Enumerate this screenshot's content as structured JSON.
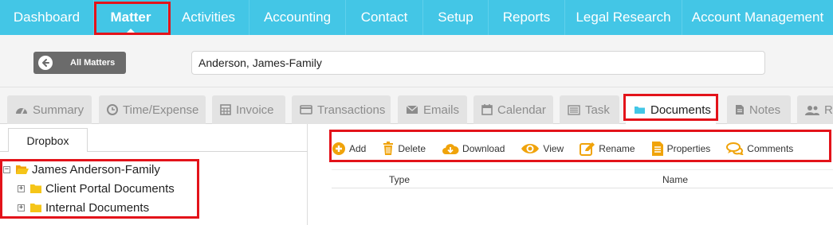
{
  "nav": {
    "items": [
      {
        "label": "Dashboard"
      },
      {
        "label": "Matter"
      },
      {
        "label": "Activities"
      },
      {
        "label": "Accounting"
      },
      {
        "label": "Contact"
      },
      {
        "label": "Setup"
      },
      {
        "label": "Reports"
      },
      {
        "label": "Legal Research"
      },
      {
        "label": "Account Management"
      }
    ],
    "active": "Matter"
  },
  "matter_bar": {
    "back_button_label": "All Matters",
    "matter_name": "Anderson, James-Family"
  },
  "tabs": [
    {
      "label": "Summary",
      "icon": "dashboard-icon"
    },
    {
      "label": "Time/Expense",
      "icon": "clock-icon"
    },
    {
      "label": "Invoice",
      "icon": "calculator-icon"
    },
    {
      "label": "Transactions",
      "icon": "credit-card-icon"
    },
    {
      "label": "Emails",
      "icon": "envelope-icon"
    },
    {
      "label": "Calendar",
      "icon": "calendar-icon"
    },
    {
      "label": "Task",
      "icon": "list-icon"
    },
    {
      "label": "Documents",
      "icon": "folder-icon"
    },
    {
      "label": "Notes",
      "icon": "file-icon"
    },
    {
      "label": "Re",
      "icon": "users-icon"
    }
  ],
  "active_tab": "Documents",
  "left_panel": {
    "subtab_label": "Dropbox",
    "tree": {
      "root": {
        "label": "James Anderson-Family",
        "expander": "−"
      },
      "children": [
        {
          "label": "Client Portal Documents",
          "expander": "+"
        },
        {
          "label": "Internal Documents",
          "expander": "+"
        }
      ]
    }
  },
  "toolbar": {
    "add": "Add",
    "delete": "Delete",
    "download": "Download",
    "view": "View",
    "rename": "Rename",
    "properties": "Properties",
    "comments": "Comments"
  },
  "table": {
    "columns": [
      "Type",
      "Name"
    ]
  },
  "colors": {
    "nav_bg": "#43c6e6",
    "accent_orange": "#f0a30a",
    "folder_yellow": "#f5c518",
    "highlight_red": "#e3131a"
  }
}
